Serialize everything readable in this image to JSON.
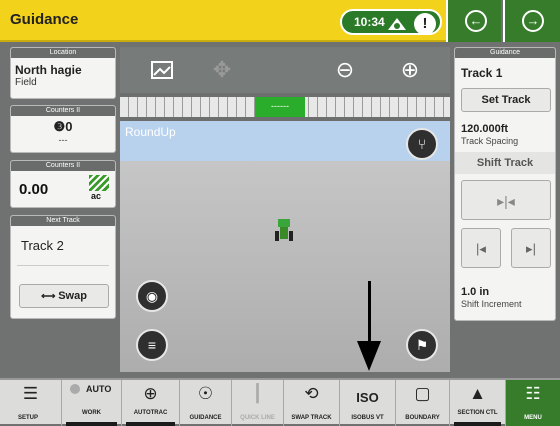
{
  "header": {
    "title": "Guidance",
    "time": "10:34",
    "alert": "!"
  },
  "nav": {
    "back": "←",
    "forward": "→"
  },
  "left": {
    "location": {
      "head": "Location",
      "name": "North hagie",
      "sub": "Field"
    },
    "counter1": {
      "head": "Counters II",
      "value": "❸0",
      "sub": "---"
    },
    "counter2": {
      "head": "Counters II",
      "value": "0.00",
      "unit": "ac"
    },
    "next_track": {
      "head": "Next Track",
      "track": "Track 2",
      "swap": "Swap"
    }
  },
  "map": {
    "label": "RoundUp",
    "center": "------"
  },
  "right": {
    "head": "Guidance",
    "track": "Track 1",
    "set_track": "Set Track",
    "spacing_value": "120.000ft",
    "spacing_label": "Track Spacing",
    "shift_track": "Shift Track",
    "shift_value": "1.0 in",
    "shift_label": "Shift Increment"
  },
  "bottom": [
    {
      "name": "setup-button",
      "label": "SETUP",
      "icon": "☰",
      "interactive": true
    },
    {
      "name": "work-button",
      "label": "WORK",
      "top": "AUTO",
      "icon": "",
      "interactive": true
    },
    {
      "name": "autotrac-button",
      "label": "AUTOTRAC",
      "icon": "⊕",
      "interactive": true
    },
    {
      "name": "guidance-button",
      "label": "GUIDANCE",
      "icon": "☉",
      "interactive": true
    },
    {
      "name": "quickline-button",
      "label": "QUICK LINE",
      "icon": "┃",
      "interactive": false
    },
    {
      "name": "swap-track-button",
      "label": "SWAP TRACK",
      "icon": "⟲",
      "interactive": true
    },
    {
      "name": "isobus-vt-button",
      "label": "ISOBUS VT",
      "icon": "ISO",
      "interactive": true
    },
    {
      "name": "boundary-button",
      "label": "BOUNDARY",
      "icon": "▢",
      "interactive": true
    },
    {
      "name": "section-ctl-button",
      "label": "SECTION CTL",
      "icon": "▲",
      "interactive": true
    },
    {
      "name": "menu-button",
      "label": "MENU",
      "icon": "☷",
      "interactive": true
    }
  ],
  "colors": {
    "accent": "#f3d21c",
    "jd_green": "#367c2b",
    "status_green": "#2aad2a"
  }
}
